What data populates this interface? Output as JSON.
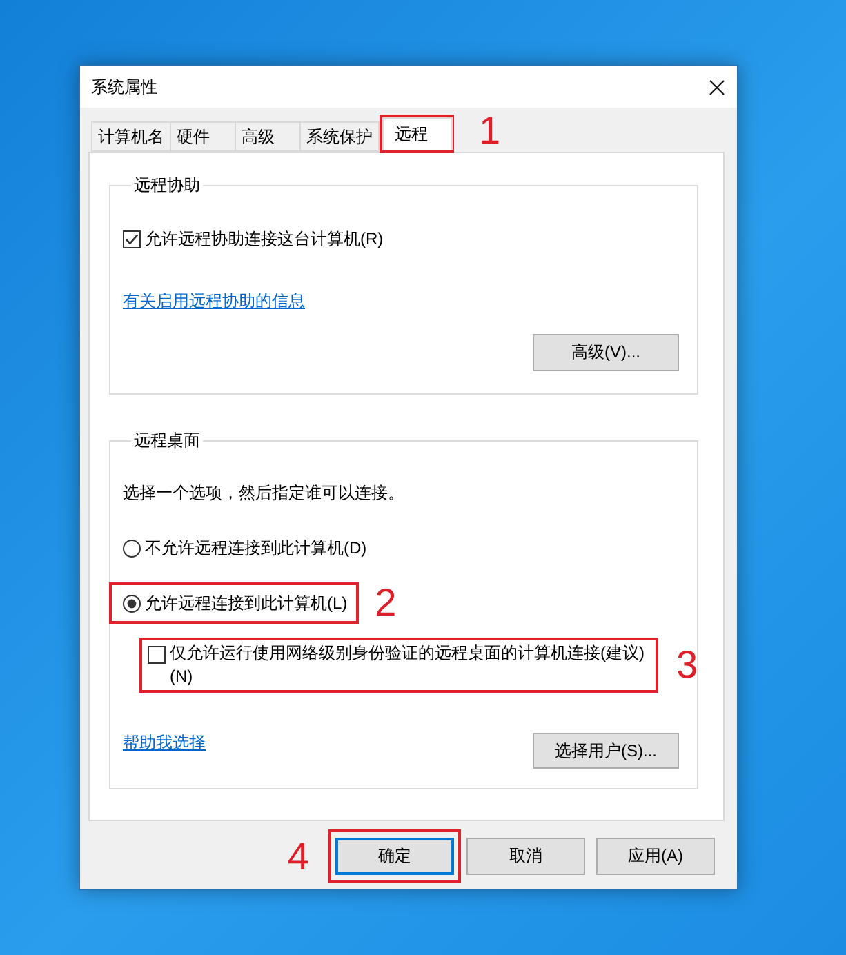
{
  "window": {
    "title": "系统属性"
  },
  "tabs": [
    {
      "label": "计算机名",
      "selected": false
    },
    {
      "label": "硬件",
      "selected": false
    },
    {
      "label": "高级",
      "selected": false
    },
    {
      "label": "系统保护",
      "selected": false
    },
    {
      "label": "远程",
      "selected": true,
      "annotation": "1"
    }
  ],
  "remote_assistance": {
    "title": "远程协助",
    "checkbox": {
      "label": "允许远程协助连接这台计算机(R)",
      "checked": true
    },
    "link": "有关启用远程协助的信息",
    "button": "高级(V)..."
  },
  "remote_desktop": {
    "title": "远程桌面",
    "instruction": "选择一个选项，然后指定谁可以连接。",
    "options": [
      {
        "label": "不允许远程连接到此计算机(D)",
        "selected": false
      },
      {
        "label": "允许远程连接到此计算机(L)",
        "selected": true,
        "annotation": "2"
      }
    ],
    "nla_checkbox": {
      "label": "仅允许运行使用网络级别身份验证的远程桌面的计算机连接(建议)(N)",
      "checked": false,
      "annotation": "3"
    },
    "link": "帮助我选择",
    "button": "选择用户(S)..."
  },
  "buttons": [
    {
      "label": "确定",
      "default": true,
      "annotation": "4"
    },
    {
      "label": "取消",
      "default": false
    },
    {
      "label": "应用(A)",
      "default": false
    }
  ]
}
